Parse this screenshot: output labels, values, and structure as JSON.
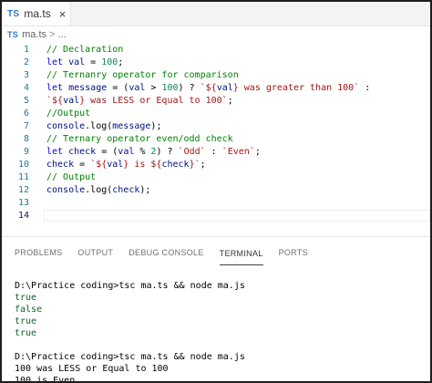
{
  "tab": {
    "badge": "TS",
    "filename": "ma.ts",
    "close": "×"
  },
  "breadcrumb": {
    "badge": "TS",
    "file": "ma.ts",
    "separator": ">",
    "rest": "..."
  },
  "editor": {
    "lines": [
      {
        "num": "1",
        "tokens": [
          {
            "t": "// Declaration",
            "c": "comment"
          }
        ]
      },
      {
        "num": "2",
        "tokens": [
          {
            "t": "let ",
            "c": "keyword"
          },
          {
            "t": "val",
            "c": "var"
          },
          {
            "t": " = ",
            "c": "plain"
          },
          {
            "t": "100",
            "c": "number"
          },
          {
            "t": ";",
            "c": "plain"
          }
        ]
      },
      {
        "num": "3",
        "tokens": [
          {
            "t": "// Ternanry operator for comparison",
            "c": "comment"
          }
        ]
      },
      {
        "num": "4",
        "tokens": [
          {
            "t": "let ",
            "c": "keyword"
          },
          {
            "t": "message",
            "c": "var"
          },
          {
            "t": " = (",
            "c": "plain"
          },
          {
            "t": "val",
            "c": "var"
          },
          {
            "t": " > ",
            "c": "plain"
          },
          {
            "t": "100",
            "c": "number"
          },
          {
            "t": ") ? ",
            "c": "plain"
          },
          {
            "t": "`${",
            "c": "string"
          },
          {
            "t": "val",
            "c": "var"
          },
          {
            "t": "} was greater than 100`",
            "c": "string"
          },
          {
            "t": " :",
            "c": "plain"
          }
        ]
      },
      {
        "num": "5",
        "tokens": [
          {
            "t": "`${",
            "c": "string"
          },
          {
            "t": "val",
            "c": "var"
          },
          {
            "t": "} was LESS or Equal to 100`",
            "c": "string"
          },
          {
            "t": ";",
            "c": "plain"
          }
        ]
      },
      {
        "num": "6",
        "tokens": [
          {
            "t": "//Output",
            "c": "comment"
          }
        ]
      },
      {
        "num": "7",
        "tokens": [
          {
            "t": "console",
            "c": "var"
          },
          {
            "t": ".log(",
            "c": "plain"
          },
          {
            "t": "message",
            "c": "var"
          },
          {
            "t": ");",
            "c": "plain"
          }
        ]
      },
      {
        "num": "8",
        "tokens": [
          {
            "t": "// Ternary operator even/odd check",
            "c": "comment"
          }
        ]
      },
      {
        "num": "9",
        "tokens": [
          {
            "t": "let ",
            "c": "keyword"
          },
          {
            "t": "check",
            "c": "var"
          },
          {
            "t": " = (",
            "c": "plain"
          },
          {
            "t": "val",
            "c": "var"
          },
          {
            "t": " % ",
            "c": "plain"
          },
          {
            "t": "2",
            "c": "number"
          },
          {
            "t": ") ? ",
            "c": "plain"
          },
          {
            "t": "`Odd`",
            "c": "string"
          },
          {
            "t": " : ",
            "c": "plain"
          },
          {
            "t": "`Even`",
            "c": "string"
          },
          {
            "t": ";",
            "c": "plain"
          }
        ]
      },
      {
        "num": "10",
        "tokens": [
          {
            "t": "check",
            "c": "var"
          },
          {
            "t": " = ",
            "c": "plain"
          },
          {
            "t": "`${",
            "c": "string"
          },
          {
            "t": "val",
            "c": "var"
          },
          {
            "t": "} is ${",
            "c": "string"
          },
          {
            "t": "check",
            "c": "var"
          },
          {
            "t": "}`",
            "c": "string"
          },
          {
            "t": ";",
            "c": "plain"
          }
        ]
      },
      {
        "num": "11",
        "tokens": [
          {
            "t": "// Output",
            "c": "comment"
          }
        ]
      },
      {
        "num": "12",
        "tokens": [
          {
            "t": "console",
            "c": "var"
          },
          {
            "t": ".log(",
            "c": "plain"
          },
          {
            "t": "check",
            "c": "var"
          },
          {
            "t": ");",
            "c": "plain"
          }
        ]
      },
      {
        "num": "13",
        "tokens": []
      },
      {
        "num": "14",
        "tokens": [],
        "current": true
      }
    ]
  },
  "panel": {
    "tabs": [
      {
        "label": "PROBLEMS",
        "active": false
      },
      {
        "label": "OUTPUT",
        "active": false
      },
      {
        "label": "DEBUG CONSOLE",
        "active": false
      },
      {
        "label": "TERMINAL",
        "active": true
      },
      {
        "label": "PORTS",
        "active": false
      }
    ]
  },
  "terminal": {
    "lines": [
      {
        "text": "D:\\Practice coding>tsc ma.ts && node ma.js",
        "kind": "prompt"
      },
      {
        "text": "true",
        "kind": "out-green"
      },
      {
        "text": "false",
        "kind": "out-green"
      },
      {
        "text": "true",
        "kind": "out-green"
      },
      {
        "text": "true",
        "kind": "out-green"
      },
      {
        "text": "",
        "kind": "blank"
      },
      {
        "text": "D:\\Practice coding>tsc ma.ts && node ma.js",
        "kind": "prompt"
      },
      {
        "text": "100 was LESS or Equal to 100",
        "kind": "out-normal"
      },
      {
        "text": "100 is Even",
        "kind": "out-normal"
      }
    ]
  }
}
